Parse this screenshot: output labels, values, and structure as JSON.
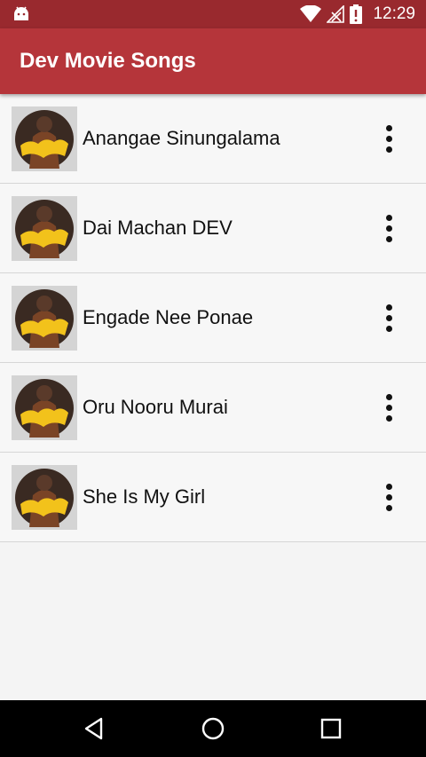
{
  "status_bar": {
    "time": "12:29",
    "icons": [
      "android-icon",
      "wifi-icon",
      "no-signal-icon",
      "battery-icon"
    ]
  },
  "app_bar": {
    "title": "Dev Movie Songs"
  },
  "songs": [
    {
      "title": "Anangae Sinungalama"
    },
    {
      "title": "Dai Machan DEV"
    },
    {
      "title": "Engade Nee Ponae"
    },
    {
      "title": "Oru Nooru Murai"
    },
    {
      "title": "She Is My Girl"
    }
  ],
  "nav_bar": {
    "icons": [
      "back-icon",
      "home-icon",
      "recents-icon"
    ]
  },
  "colors": {
    "status_bar": "#99292e",
    "app_bar": "#b5353a",
    "background": "#f4f4f4",
    "thumb_accent": "#f2c21b"
  }
}
